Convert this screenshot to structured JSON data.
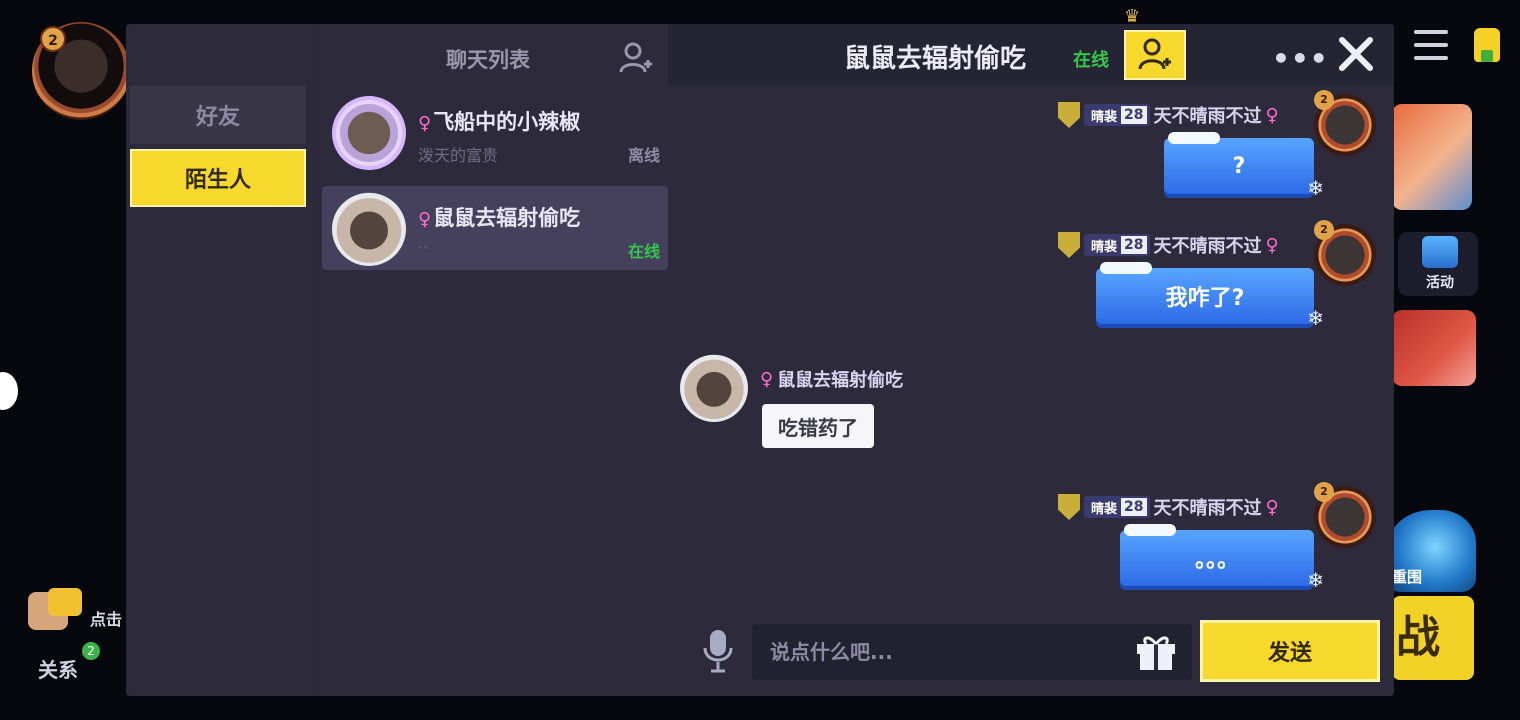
{
  "background": {
    "player_level": "2",
    "activity_label": "活动",
    "mode_label": "重围",
    "mode_button_text": "战",
    "tap_hint": "点击",
    "relation_label": "关系",
    "relation_badge": "2"
  },
  "nav": {
    "friends_label": "好友",
    "strangers_label": "陌生人",
    "selected": "strangers"
  },
  "chat_list": {
    "title": "聊天列表",
    "items": [
      {
        "name": "飞船中的小辣椒",
        "gender_icon": "female-symbol",
        "subtitle": "泼天的富贵",
        "status": "离线",
        "active": false
      },
      {
        "name": "鼠鼠去辐射偷吃",
        "gender_icon": "female-symbol",
        "subtitle": "··",
        "status": "在线",
        "active": true
      }
    ]
  },
  "chat": {
    "partner_name": "鼠鼠去辐射偷吃",
    "partner_status": "在线",
    "more_label": "•••",
    "messages": [
      {
        "side": "right",
        "title": "晴裴",
        "level": "28",
        "sender": "天不晴雨不过",
        "avatar_level": "2",
        "text": "?"
      },
      {
        "side": "right",
        "title": "晴裴",
        "level": "28",
        "sender": "天不晴雨不过",
        "avatar_level": "2",
        "text": "我咋了?"
      },
      {
        "side": "left",
        "sender": "鼠鼠去辐射偷吃",
        "text": "吃错药了"
      },
      {
        "side": "right",
        "title": "晴裴",
        "level": "28",
        "sender": "天不晴雨不过",
        "avatar_level": "2",
        "text": "。。。"
      }
    ],
    "input_placeholder": "说点什么吧...",
    "input_value": "",
    "send_label": "发送"
  },
  "colors": {
    "accent_yellow": "#f7d82d",
    "online_green": "#35c64a",
    "bubble_blue": "#3f86f4",
    "gender_pink": "#ff6ccf"
  }
}
